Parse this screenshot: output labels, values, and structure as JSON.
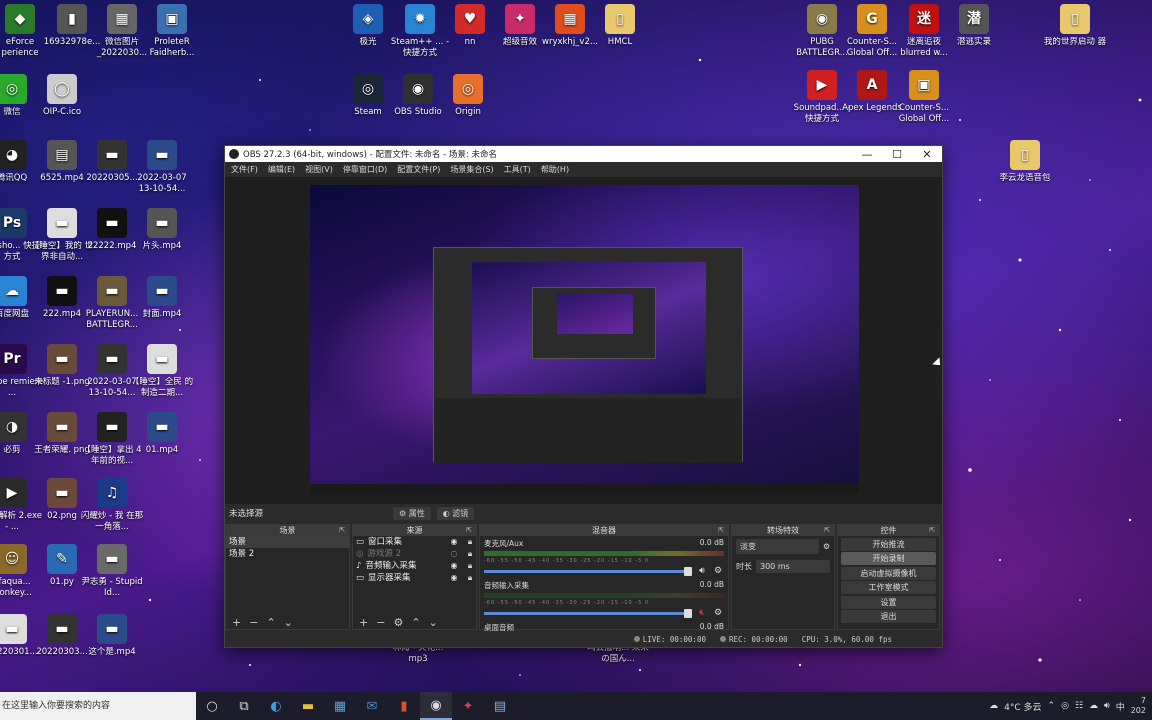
{
  "desktop_icons": [
    {
      "label": "eForce\nperience",
      "glyph": "◆",
      "color": "#2a7a2a"
    },
    {
      "label": "16932978e...",
      "glyph": "▮",
      "color": "#555"
    },
    {
      "label": "微信图片\n_2022030...",
      "glyph": "▦",
      "color": "#666"
    },
    {
      "label": "ProleteR\nFaidherb...",
      "glyph": "▣",
      "color": "#3a6fb0"
    },
    {
      "label": "极光",
      "glyph": "◈",
      "color": "#1e5fb5"
    },
    {
      "label": "Steam++ ...\n- 快捷方式",
      "glyph": "✹",
      "color": "#2a84d4"
    },
    {
      "label": "nn",
      "glyph": "♥",
      "color": "#d42a2a"
    },
    {
      "label": "超级音效",
      "glyph": "✦",
      "color": "#c82a6a"
    },
    {
      "label": "wryxkhj_v2...",
      "glyph": "▦",
      "color": "#e04c1c"
    },
    {
      "label": "HMCL",
      "glyph": "▯",
      "color": "#e8c86a"
    },
    {
      "label": "PUBG\nBATTLEGR...",
      "glyph": "◉",
      "color": "#8a7a4a"
    },
    {
      "label": "Counter-S...\nGlobal Off...",
      "glyph": "G",
      "color": "#d8901c"
    },
    {
      "label": "迷离追夜\nblurred w...",
      "glyph": "迷",
      "color": "#c01010"
    },
    {
      "label": "潜逃实录",
      "glyph": "潜",
      "color": "#555"
    },
    {
      "label": "我的世界启动\n器",
      "glyph": "▯",
      "color": "#e8c86a"
    },
    {
      "label": "微信",
      "glyph": "◎",
      "color": "#2aa82a"
    },
    {
      "label": "OIP-C.ico",
      "glyph": "◯",
      "color": "#ccc"
    },
    {
      "label": "Steam",
      "glyph": "◎",
      "color": "#1b2838"
    },
    {
      "label": "OBS Studio",
      "glyph": "◉",
      "color": "#303030"
    },
    {
      "label": "Origin",
      "glyph": "◎",
      "color": "#e8702a"
    },
    {
      "label": "Soundpad...\n- 快捷方式",
      "glyph": "▶",
      "color": "#d02020"
    },
    {
      "label": "Apex\nLegends",
      "glyph": "A",
      "color": "#b01818"
    },
    {
      "label": "Counter-S...\nGlobal Off...",
      "glyph": "▣",
      "color": "#d8901c"
    },
    {
      "label": "腾讯QQ",
      "glyph": "◕",
      "color": "#222"
    },
    {
      "label": "6525.mp4",
      "glyph": "▤",
      "color": "#555"
    },
    {
      "label": "20220305...",
      "glyph": "▬",
      "color": "#333"
    },
    {
      "label": "2022-03-07\n13-10-54...",
      "glyph": "▬",
      "color": "#2a4a8a"
    },
    {
      "label": "李云龙语音包",
      "glyph": "▯",
      "color": "#e8c86a"
    },
    {
      "label": "otosho...\n快捷方式",
      "glyph": "Ps",
      "color": "#1a3a6a"
    },
    {
      "label": "【睡空】我的\n世界非自动...",
      "glyph": "▬",
      "color": "#ddd"
    },
    {
      "label": "22222.mp4",
      "glyph": "▬",
      "color": "#111"
    },
    {
      "label": "片头.mp4",
      "glyph": "▬",
      "color": "#555"
    },
    {
      "label": "百度网盘",
      "glyph": "☁",
      "color": "#2a84d4"
    },
    {
      "label": "222.mp4",
      "glyph": "▬",
      "color": "#111"
    },
    {
      "label": "PLAYERUN...\nBATTLEGR...",
      "glyph": "▬",
      "color": "#6a5a3a"
    },
    {
      "label": "封面.mp4",
      "glyph": "▬",
      "color": "#2a4a8a"
    },
    {
      "label": "Adobe\nremiere ...",
      "glyph": "Pr",
      "color": "#2a0a4a"
    },
    {
      "label": "未标题\n-1.png",
      "glyph": "▬",
      "color": "#6a4a3a"
    },
    {
      "label": "2022-03-07\n13-10-54...",
      "glyph": "▬",
      "color": "#333"
    },
    {
      "label": "【睡空】全民\n的制造二期...",
      "glyph": "▬",
      "color": "#ddd"
    },
    {
      "label": "必剪",
      "glyph": "◑",
      "color": "#333"
    },
    {
      "label": "王者荣耀.\npng",
      "glyph": "▬",
      "color": "#6a4a3a"
    },
    {
      "label": "【睡空】拿出\n4年前的视...",
      "glyph": "▬",
      "color": "#222"
    },
    {
      "label": "01.mp4",
      "glyph": "▬",
      "color": "#2a4a8a"
    },
    {
      "label": "视频解析\n2.exe - ...",
      "glyph": "▶",
      "color": "#2a2a2a"
    },
    {
      "label": "02.png",
      "glyph": "▬",
      "color": "#6a4a3a"
    },
    {
      "label": "闪耀炒 - 我\n在那一角落...",
      "glyph": "♫",
      "color": "#1a3a8a"
    },
    {
      "label": "ofaqua...\nMonkey...",
      "glyph": "☺",
      "color": "#8a6a2a"
    },
    {
      "label": "01.py",
      "glyph": "✎",
      "color": "#2a6ab0"
    },
    {
      "label": "尹志勇 -\nStupid Id...",
      "glyph": "▬",
      "color": "#6a6a6a"
    },
    {
      "label": "20220301...",
      "glyph": "▬",
      "color": "#ddd"
    },
    {
      "label": "20220303...",
      "glyph": "▬",
      "color": "#333"
    },
    {
      "label": "这个是.mp4",
      "glyph": "▬",
      "color": "#2a4a8a"
    },
    {
      "label": "林海 - 火花...\nmp3",
      "glyph": "",
      "color": "transparent"
    },
    {
      "label": "鸣丢撒呐...\n来来の国ん...",
      "glyph": "",
      "color": "transparent"
    }
  ],
  "obs": {
    "title": "OBS 27.2.3 (64-bit, windows) - 配置文件: 未命名 - 场景: 未命名",
    "menu": [
      "文件(F)",
      "编辑(E)",
      "视图(V)",
      "停靠窗口(D)",
      "配置文件(P)",
      "场景集合(S)",
      "工具(T)",
      "帮助(H)"
    ],
    "source_bar": {
      "label": "未选择源",
      "properties": "属性",
      "filters": "滤镜"
    },
    "scenes": {
      "title": "场景",
      "items": [
        "场景",
        "场景 2"
      ]
    },
    "sources": {
      "title": "来源",
      "items": [
        {
          "label": "窗口采集",
          "icon": "window-icon",
          "dim": false
        },
        {
          "label": "游戏源 2",
          "icon": "gamepad-icon",
          "dim": true
        },
        {
          "label": "音频输入采集",
          "icon": "mic-icon",
          "dim": false
        },
        {
          "label": "显示器采集",
          "icon": "monitor-icon",
          "dim": false
        }
      ]
    },
    "mixer": {
      "title": "混音器",
      "channels": [
        {
          "name": "麦克风/Aux",
          "db": "0.0 dB",
          "active": true,
          "muted": false
        },
        {
          "name": "音频输入采集",
          "db": "0.0 dB",
          "active": false,
          "muted": true
        },
        {
          "name": "桌面音频",
          "db": "0.0 dB",
          "active": false,
          "muted": false
        }
      ],
      "scale": "-60 -55 -50 -45 -40 -35 -30 -25 -20 -15 -10 -5 0"
    },
    "transitions": {
      "title": "转场特效",
      "type": "淡变",
      "duration_label": "时长",
      "duration": "300 ms"
    },
    "controls": {
      "title": "控件",
      "buttons": [
        "开始推流",
        "开始录制",
        "启动虚拟摄像机",
        "工作室模式",
        "设置",
        "退出"
      ]
    },
    "status": {
      "live": "LIVE: 00:00:00",
      "rec": "REC: 00:00:00",
      "cpu": "CPU: 3.0%, 60.00 fps"
    }
  },
  "taskbar": {
    "search_placeholder": "在这里输入你要搜索的内容",
    "weather": "4°C 多云",
    "ime": "中",
    "clock_time": "7",
    "clock_date": "202"
  }
}
